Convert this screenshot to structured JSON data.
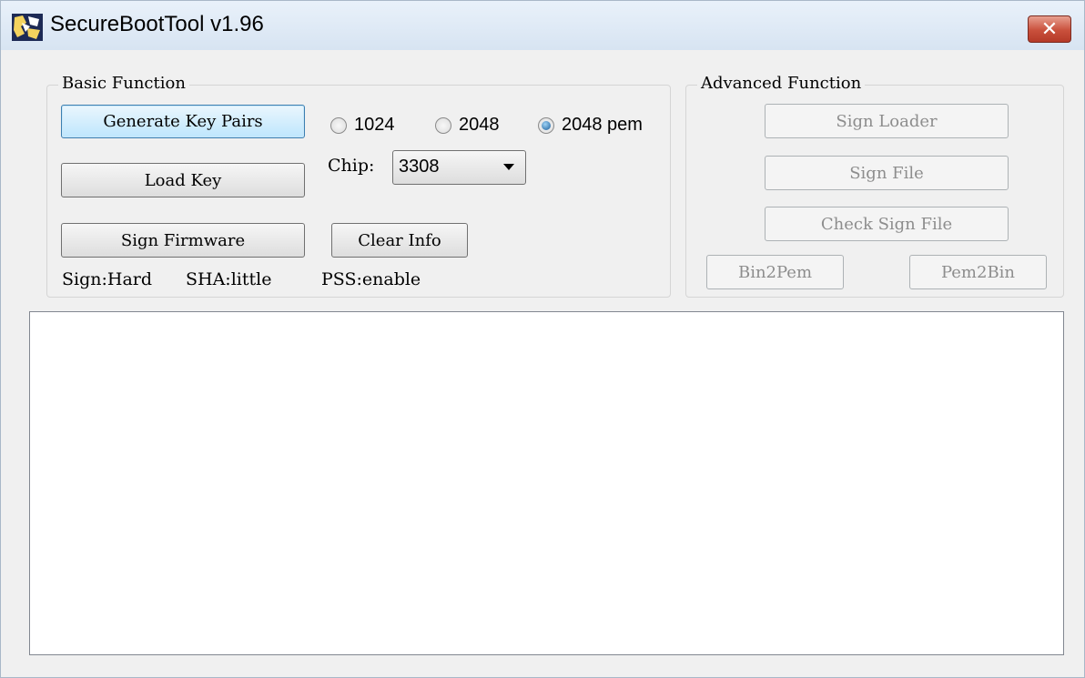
{
  "window": {
    "title": "SecureBootTool v1.96",
    "close_glyph": "✕",
    "icon": "app-logo-icon"
  },
  "basic": {
    "label": "Basic Function",
    "generate_button": "Generate Key Pairs",
    "load_key_button": "Load Key",
    "sign_firmware_button": "Sign Firmware",
    "clear_info_button": "Clear Info",
    "key_size_options": [
      {
        "label": "1024",
        "checked": false
      },
      {
        "label": "2048",
        "checked": false
      },
      {
        "label": "2048 pem",
        "checked": true
      }
    ],
    "chip_label": "Chip:",
    "chip_value": "3308",
    "status_sign": "Sign:Hard",
    "status_sha": "SHA:little",
    "status_pss": "PSS:enable"
  },
  "advanced": {
    "label": "Advanced Function",
    "sign_loader_button": "Sign Loader",
    "sign_file_button": "Sign File",
    "check_sign_file_button": "Check Sign File",
    "bin2pem_button": "Bin2Pem",
    "pem2bin_button": "Pem2Bin"
  },
  "log": {
    "content": ""
  },
  "colors": {
    "titlebar": "#dce7f3",
    "close_red": "#c9503c",
    "focused_border": "#3c7fb1",
    "disabled_text": "#8d8d8d"
  }
}
